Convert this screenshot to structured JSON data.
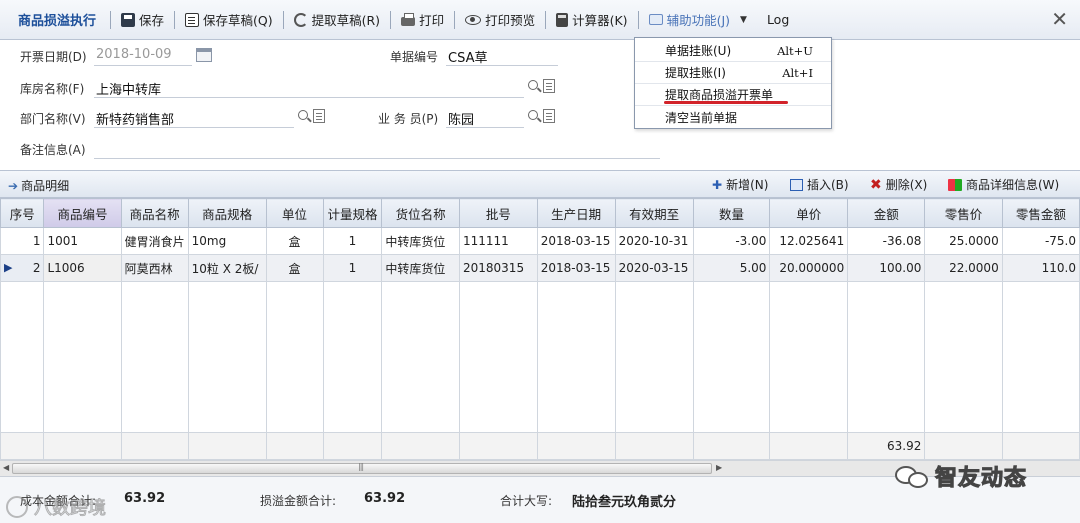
{
  "toolbar": {
    "title": "商品损溢执行",
    "save": "保存",
    "save_draft": "保存草稿(Q)",
    "fetch_draft": "提取草稿(R)",
    "print": "打印",
    "print_preview": "打印预览",
    "calculator": "计算器(K)",
    "aux": "辅助功能(J)",
    "log": "Log",
    "close": "✕"
  },
  "form": {
    "invoice_date_label": "开票日期(D)",
    "invoice_date": "2018-10-09",
    "doc_no_label": "单据编号",
    "doc_no": "CSA草",
    "warehouse_label": "库房名称(F)",
    "warehouse": "上海中转库",
    "dept_label": "部门名称(V)",
    "dept": "新特药销售部",
    "salesman_label": "业 务 员(P)",
    "salesman": "陈园",
    "remark_label": "备注信息(A)",
    "remark": ""
  },
  "menu": {
    "items": [
      {
        "label": "单据挂账(U)",
        "shortcut": "Alt+U"
      },
      {
        "label": "提取挂账(I)",
        "shortcut": "Alt+I"
      },
      {
        "label": "提取商品损溢开票单",
        "shortcut": ""
      },
      {
        "label": "清空当前单据",
        "shortcut": ""
      }
    ]
  },
  "detail": {
    "title": "商品明细",
    "add": "新增(N)",
    "insert": "插入(B)",
    "delete": "删除(X)",
    "detail_info": "商品详细信息(W)"
  },
  "table": {
    "columns": [
      "序号",
      "商品编号",
      "商品名称",
      "商品规格",
      "单位",
      "计量规格",
      "货位名称",
      "批号",
      "生产日期",
      "有效期至",
      "数量",
      "单价",
      "金额",
      "零售价",
      "零售金额"
    ],
    "rows": [
      [
        "1",
        "1001",
        "健胃消食片",
        "10mg",
        "盒",
        "1",
        "中转库货位",
        "111111",
        "2018-03-15",
        "2020-10-31",
        "-3.00",
        "12.025641",
        "-36.08",
        "25.0000",
        "-75.0"
      ],
      [
        "2",
        "L1006",
        "阿莫西林",
        "10粒 X 2板/",
        "盒",
        "1",
        "中转库货位",
        "20180315",
        "2018-03-15",
        "2020-03-15",
        "5.00",
        "20.000000",
        "100.00",
        "22.0000",
        "110.0"
      ]
    ],
    "total_amount": "63.92"
  },
  "footer": {
    "cost_total_label": "成本金额合计:",
    "cost_total": "63.92",
    "diff_total_label": "损溢金额合计:",
    "diff_total": "63.92",
    "upper_label": "合计大写:",
    "upper": "陆拾叁元玖角贰分"
  },
  "watermark": {
    "right": "智友动态",
    "left": "八数跨境"
  }
}
